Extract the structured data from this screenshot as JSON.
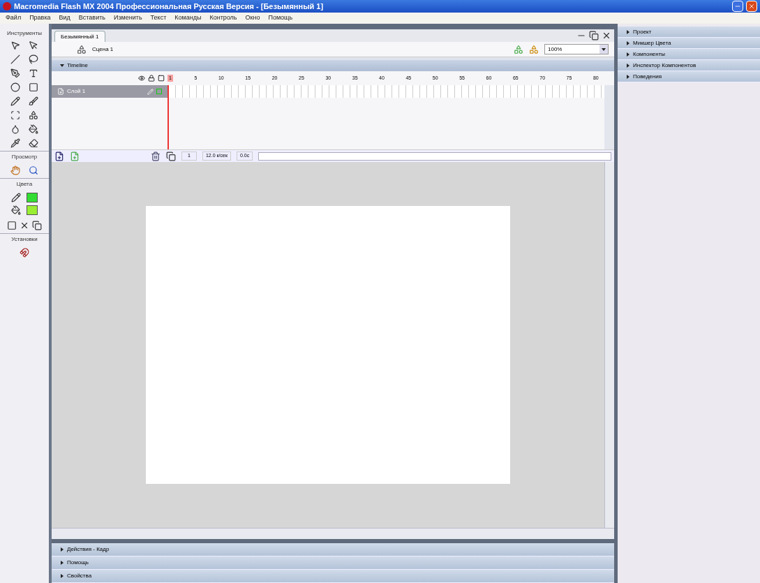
{
  "window": {
    "title": "Macromedia Flash MX 2004 Профессиональная Русская Версия - [Безымянный 1]"
  },
  "menu": [
    "Файл",
    "Правка",
    "Вид",
    "Вставить",
    "Изменить",
    "Текст",
    "Команды",
    "Контроль",
    "Окно",
    "Помощь"
  ],
  "toolbox": {
    "sections": [
      {
        "title": "Инструменты"
      },
      {
        "title": "Просмотр"
      },
      {
        "title": "Цвета"
      },
      {
        "title": "Установки"
      }
    ],
    "swatches": [
      {
        "kind": "stroke",
        "color": "#33dd33"
      },
      {
        "kind": "fill",
        "color": "#99ee33"
      }
    ]
  },
  "document": {
    "tab": "Безымянный 1",
    "scene": "Сцена 1",
    "zoom": "100%",
    "timeline": {
      "title": "Timeline",
      "expanded": true,
      "frame_numbers": [
        "1",
        "5",
        "10",
        "15",
        "20",
        "25",
        "30",
        "35",
        "40",
        "45",
        "50",
        "55",
        "60",
        "65",
        "70",
        "75",
        "80"
      ],
      "layers": [
        {
          "name": "Слой 1",
          "selected": true
        }
      ],
      "current_frame": "1",
      "frame_rate": "12.0 к/сек",
      "time": "0.0с"
    }
  },
  "bottom_panels": [
    {
      "title": "Действия - Кадр",
      "expanded": false
    },
    {
      "title": "Помощь",
      "expanded": false
    },
    {
      "title": "Свойства",
      "expanded": false
    }
  ],
  "right_panels": [
    {
      "title": "Проект",
      "expanded": false
    },
    {
      "title": "Микшер Цвета",
      "expanded": false
    },
    {
      "title": "Компоненты",
      "expanded": false
    },
    {
      "title": "Инспектор Компонентов",
      "expanded": false
    },
    {
      "title": "Поведения",
      "expanded": false
    }
  ]
}
